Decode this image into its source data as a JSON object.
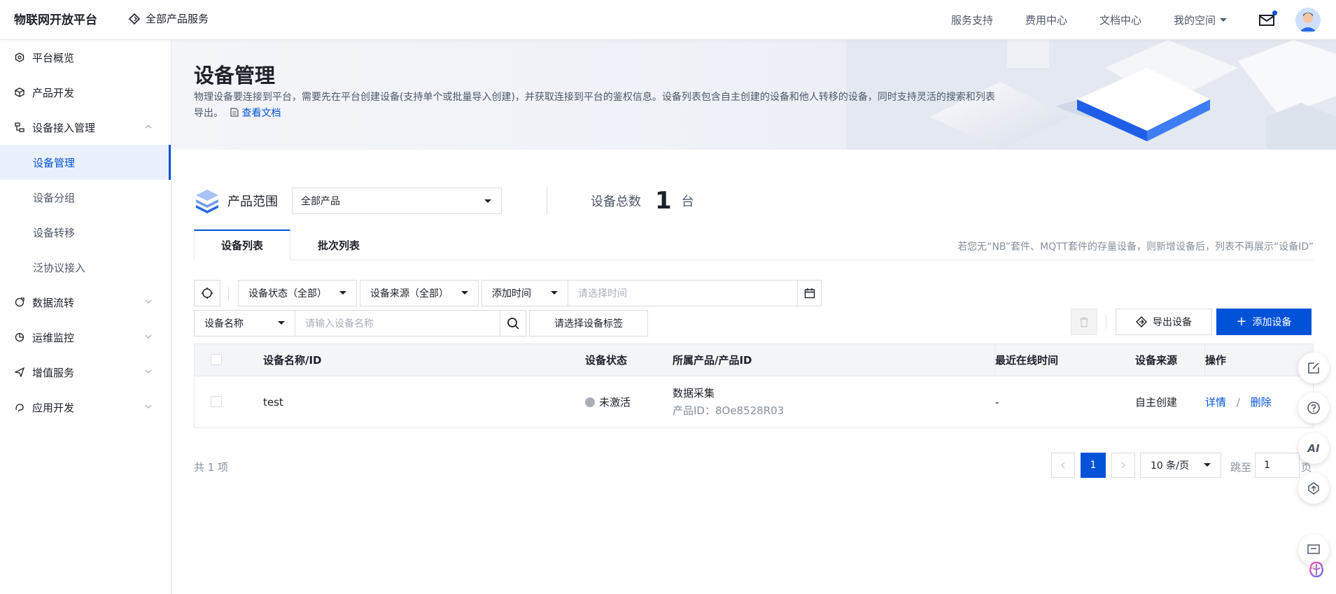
{
  "topbar": {
    "brand": "物联网开放平台",
    "all_products": "全部产品服务",
    "nav": [
      "服务支持",
      "费用中心",
      "文档中心",
      "我的空间"
    ]
  },
  "sidebar": {
    "items": [
      {
        "label": "平台概览",
        "icon": "hexagon-icon"
      },
      {
        "label": "产品开发",
        "icon": "cube-icon"
      },
      {
        "label": "设备接入管理",
        "icon": "device-tree-icon"
      },
      {
        "label": "数据流转",
        "icon": "data-flow-icon"
      },
      {
        "label": "运维监控",
        "icon": "pie-chart-icon"
      },
      {
        "label": "增值服务",
        "icon": "send-icon"
      },
      {
        "label": "应用开发",
        "icon": "app-dev-icon"
      }
    ],
    "sub_items": [
      "设备管理",
      "设备分组",
      "设备转移",
      "泛协议接入"
    ]
  },
  "hero": {
    "title": "设备管理",
    "desc": "物理设备要连接到平台，需要先在平台创建设备(支持单个或批量导入创建)，并获取连接到平台的鉴权信息。设备列表包含自主创建的设备和他人转移的设备，同时支持灵活的搜索和列表导出。",
    "doc_link": "查看文档"
  },
  "scope": {
    "label": "产品范围",
    "product_select": "全部产品",
    "total_label": "设备总数",
    "total_value": "1",
    "total_unit": "台"
  },
  "tabs": {
    "list": "设备列表",
    "batch": "批次列表",
    "hint": "若您无“NB”套件、MQTT套件的存量设备，则新增设备后，列表不再展示“设备ID”"
  },
  "filters": {
    "status": "设备状态（全部）",
    "source": "设备来源（全部）",
    "time_type": "添加时间",
    "time_placeholder": "请选择时间",
    "name_type": "设备名称",
    "name_placeholder": "请输入设备名称",
    "tag_placeholder": "请选择设备标签"
  },
  "actions": {
    "export": "导出设备",
    "add": "添加设备"
  },
  "table": {
    "headers": {
      "name": "设备名称/ID",
      "status": "设备状态",
      "product": "所属产品/产品ID",
      "last_online": "最近在线时间",
      "source": "设备来源",
      "ops": "操作"
    },
    "rows": [
      {
        "name": "test",
        "status": "未激活",
        "product": "数据采集",
        "product_id": "产品ID：8Oe8528R03",
        "last_online": "-",
        "source": "自主创建",
        "detail": "详情",
        "sep": "/",
        "delete": "删除"
      }
    ]
  },
  "pagination": {
    "total": "共 1 项",
    "current": "1",
    "page_size": "10 条/页",
    "jump_label": "跳至",
    "jump_value": "1",
    "page_unit": "页"
  },
  "float_tools": {
    "ai": "AI"
  },
  "colors": {
    "primary": "#0052d9",
    "sidebar_active_bg": "#ebf1fc"
  }
}
